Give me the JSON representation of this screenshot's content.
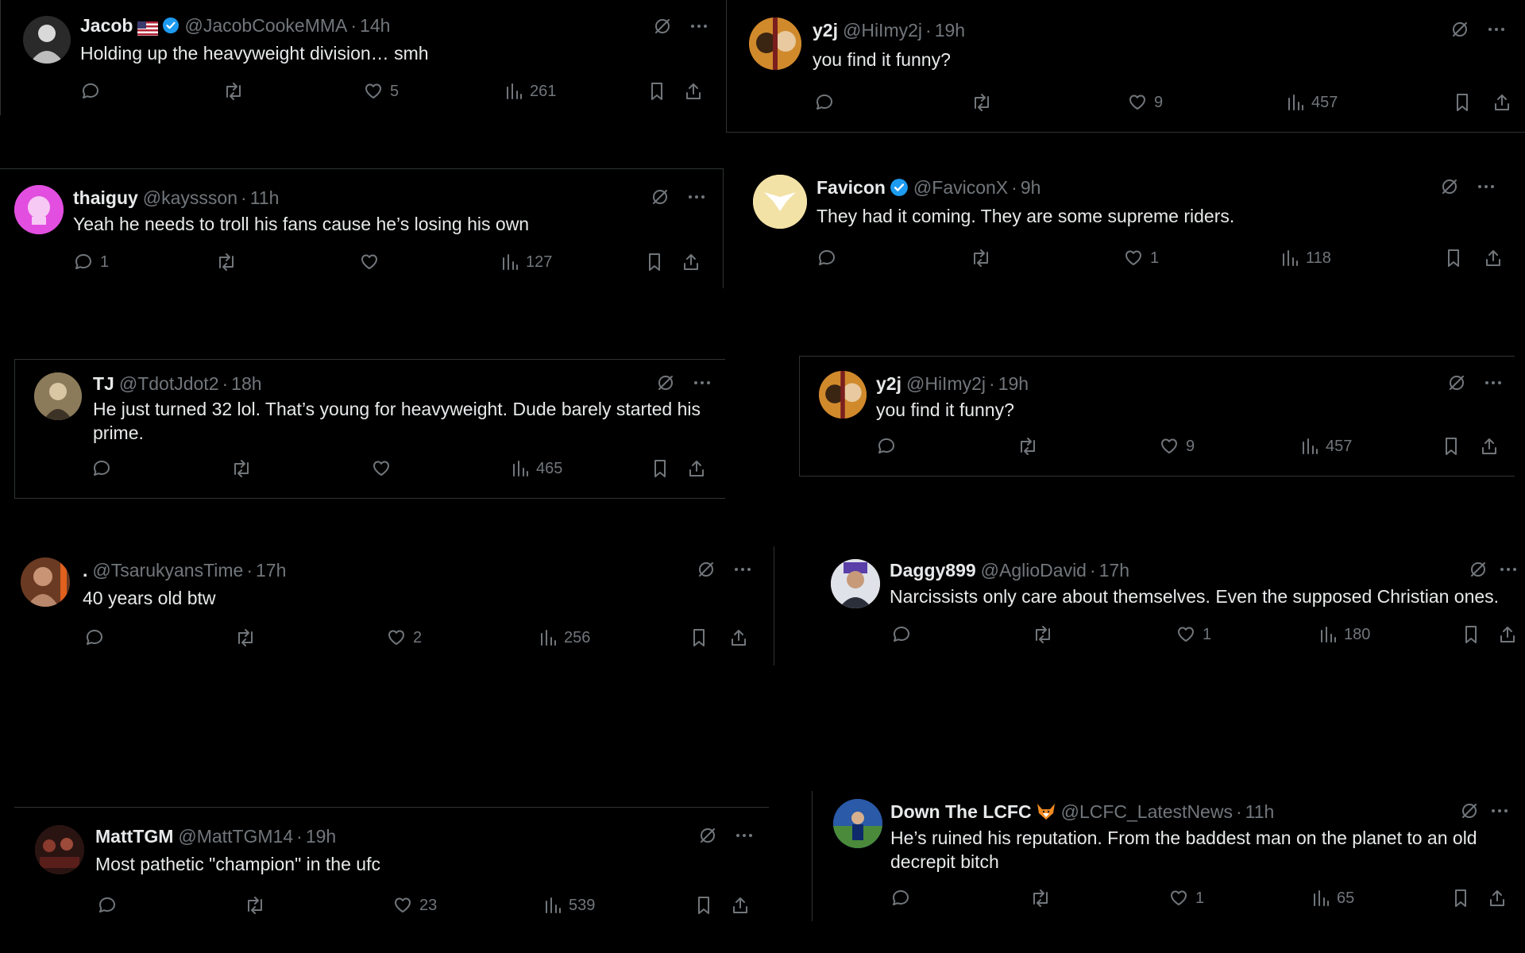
{
  "tweets": [
    {
      "name": "Jacob",
      "handle": "@JacobCookeMMA",
      "time": "14h",
      "text": "Holding up the heavyweight division… smh",
      "reply": "",
      "retweet": "",
      "like": "5",
      "views": "261"
    },
    {
      "name": "y2j",
      "handle": "@HiImy2j",
      "time": "19h",
      "text": "you find it funny?",
      "reply": "",
      "retweet": "",
      "like": "9",
      "views": "457"
    },
    {
      "name": "thaiguy",
      "handle": "@kayssson",
      "time": "11h",
      "text": "Yeah he needs to troll his fans cause he’s losing his own",
      "reply": "1",
      "retweet": "",
      "like": "",
      "views": "127"
    },
    {
      "name": "Favicon",
      "handle": "@FaviconX",
      "time": "9h",
      "text": "They had it coming. They are some supreme riders.",
      "reply": "",
      "retweet": "",
      "like": "1",
      "views": "118"
    },
    {
      "name": "TJ",
      "handle": "@TdotJdot2",
      "time": "18h",
      "text": "He just turned 32 lol. That’s young for heavyweight.  Dude barely started his prime.",
      "reply": "",
      "retweet": "",
      "like": "",
      "views": "465"
    },
    {
      "name": "y2j",
      "handle": "@HiImy2j",
      "time": "19h",
      "text": "you find it funny?",
      "reply": "",
      "retweet": "",
      "like": "9",
      "views": "457"
    },
    {
      "name": ".",
      "handle": "@TsarukyansTime",
      "time": "17h",
      "text": "40 years old btw",
      "reply": "",
      "retweet": "",
      "like": "2",
      "views": "256"
    },
    {
      "name": "Daggy899",
      "handle": "@AglioDavid",
      "time": "17h",
      "text": "Narcissists only care about themselves. Even the supposed Christian ones.",
      "reply": "",
      "retweet": "",
      "like": "1",
      "views": "180"
    },
    {
      "name": "MattTGM",
      "handle": "@MattTGM14",
      "time": "19h",
      "text": "Most pathetic \"champion\" in the ufc",
      "reply": "",
      "retweet": "",
      "like": "23",
      "views": "539"
    },
    {
      "name": "Down The LCFC",
      "handle": "@LCFC_LatestNews",
      "time": "11h",
      "text": "He’s ruined his reputation. From the baddest man on the planet to an old decrepit bitch",
      "reply": "",
      "retweet": "",
      "like": "1",
      "views": "65"
    }
  ],
  "separator": "·",
  "icons": {
    "verified": "verified-badge-icon",
    "flag": "us-flag-icon",
    "fox": "fox-emoji-icon",
    "grok": "grok-icon",
    "more": "more-icon",
    "reply": "reply-icon",
    "retweet": "retweet-icon",
    "like": "like-icon",
    "views": "views-icon",
    "bookmark": "bookmark-icon",
    "share": "share-icon"
  },
  "colors": {
    "background": "#000000",
    "text": "#e7e9ea",
    "muted": "#71767b",
    "verified": "#1d9bf0",
    "border": "#2f3336"
  }
}
